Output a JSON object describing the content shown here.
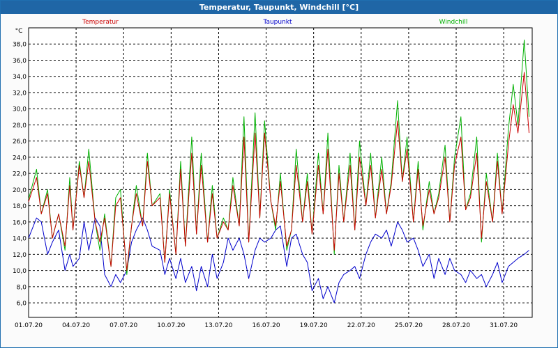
{
  "window": {
    "title": "Temperatur, Taupunkt, Windchill [°C]"
  },
  "chart_data": {
    "type": "line",
    "title": "Temperatur, Taupunkt, Windchill [°C]",
    "ylabel": "°C",
    "ylim": [
      4.2,
      40.0
    ],
    "xlim": [
      0,
      31.8
    ],
    "grid": true,
    "legend": "top",
    "yticks": [
      "6,0",
      "8,0",
      "10,0",
      "12,0",
      "14,0",
      "16,0",
      "18,0",
      "20,0",
      "22,0",
      "24,0",
      "26,0",
      "28,0",
      "30,0",
      "32,0",
      "34,0",
      "36,0",
      "38,0"
    ],
    "ytick_values": [
      6,
      8,
      10,
      12,
      14,
      16,
      18,
      20,
      22,
      24,
      26,
      28,
      30,
      32,
      34,
      36,
      38
    ],
    "xticks": [
      "01.07.20",
      "04.07.20",
      "07.07.20",
      "10.07.20",
      "13.07.20",
      "16.07.20",
      "19.07.20",
      "22.07.20",
      "25.07.20",
      "28.07.20",
      "31.07.20"
    ],
    "xtick_values": [
      0,
      3,
      6,
      9,
      12,
      15,
      18,
      21,
      24,
      27,
      30
    ],
    "series": [
      {
        "name": "Temperatur",
        "color": "#cc0000",
        "x": [
          0,
          0.5,
          0.8,
          1.2,
          1.5,
          1.9,
          2.3,
          2.6,
          2.8,
          3.2,
          3.5,
          3.8,
          4.2,
          4.5,
          4.8,
          5.2,
          5.5,
          5.8,
          6.2,
          6.5,
          6.8,
          7.2,
          7.5,
          7.8,
          8.3,
          8.6,
          8.9,
          9.3,
          9.6,
          9.9,
          10.3,
          10.6,
          10.9,
          11.3,
          11.6,
          11.9,
          12.3,
          12.6,
          12.9,
          13.3,
          13.6,
          13.9,
          14.3,
          14.6,
          14.9,
          15.3,
          15.6,
          15.9,
          16.3,
          16.6,
          16.9,
          17.3,
          17.6,
          17.9,
          18.3,
          18.6,
          18.9,
          19.3,
          19.6,
          19.9,
          20.3,
          20.6,
          20.9,
          21.3,
          21.6,
          21.9,
          22.3,
          22.6,
          22.9,
          23.3,
          23.6,
          23.9,
          24.3,
          24.6,
          24.9,
          25.3,
          25.6,
          25.9,
          26.3,
          26.6,
          26.9,
          27.3,
          27.6,
          27.9,
          28.3,
          28.6,
          28.9,
          29.3,
          29.6,
          29.9,
          30.3,
          30.6,
          30.9,
          31.3,
          31.6
        ],
        "values": [
          18.5,
          21.5,
          17.0,
          19.5,
          14.0,
          17.0,
          13.0,
          20.5,
          15.0,
          23.0,
          19.0,
          23.5,
          16.0,
          13.5,
          16.5,
          10.5,
          18.0,
          19.0,
          10.0,
          15.5,
          19.5,
          15.5,
          23.5,
          18.0,
          19.0,
          11.0,
          19.5,
          12.0,
          22.5,
          13.0,
          24.5,
          14.5,
          23.0,
          13.5,
          19.5,
          14.0,
          16.0,
          15.0,
          20.5,
          15.5,
          26.5,
          13.5,
          27.0,
          16.5,
          27.0,
          18.5,
          15.5,
          21.0,
          13.0,
          15.0,
          23.0,
          16.0,
          21.0,
          14.5,
          23.0,
          17.0,
          25.0,
          12.5,
          22.0,
          16.0,
          23.0,
          15.0,
          24.0,
          18.0,
          23.0,
          16.5,
          22.5,
          17.0,
          20.5,
          28.5,
          21.0,
          25.0,
          16.0,
          22.5,
          15.5,
          20.0,
          17.0,
          19.0,
          24.0,
          16.0,
          23.0,
          26.5,
          17.5,
          19.0,
          24.5,
          14.0,
          21.0,
          16.0,
          23.5,
          17.0,
          25.5,
          30.5,
          27.0,
          34.5,
          27.0
        ]
      },
      {
        "name": "Taupunkt",
        "color": "#0000cc",
        "x": [
          0,
          0.5,
          0.8,
          1.2,
          1.5,
          1.9,
          2.3,
          2.6,
          2.8,
          3.2,
          3.5,
          3.8,
          4.2,
          4.5,
          4.8,
          5.2,
          5.5,
          5.8,
          6.2,
          6.5,
          6.8,
          7.2,
          7.5,
          7.8,
          8.3,
          8.6,
          8.9,
          9.3,
          9.6,
          9.9,
          10.3,
          10.6,
          10.9,
          11.3,
          11.6,
          11.9,
          12.3,
          12.6,
          12.9,
          13.3,
          13.6,
          13.9,
          14.3,
          14.6,
          14.9,
          15.3,
          15.6,
          15.9,
          16.3,
          16.6,
          16.9,
          17.3,
          17.6,
          17.9,
          18.3,
          18.6,
          18.9,
          19.3,
          19.6,
          19.9,
          20.3,
          20.6,
          20.9,
          21.3,
          21.6,
          21.9,
          22.3,
          22.6,
          22.9,
          23.3,
          23.6,
          23.9,
          24.3,
          24.6,
          24.9,
          25.3,
          25.6,
          25.9,
          26.3,
          26.6,
          26.9,
          27.3,
          27.6,
          27.9,
          28.3,
          28.6,
          28.9,
          29.3,
          29.6,
          29.9,
          30.3,
          30.6,
          30.9,
          31.3,
          31.6
        ],
        "values": [
          14.0,
          16.5,
          16.0,
          12.0,
          13.5,
          15.0,
          10.0,
          12.0,
          10.5,
          11.5,
          16.0,
          12.5,
          16.5,
          15.5,
          9.5,
          8.0,
          9.5,
          8.5,
          10.0,
          13.5,
          15.0,
          16.5,
          15.0,
          13.0,
          12.5,
          9.5,
          11.5,
          9.0,
          11.5,
          8.5,
          10.5,
          7.5,
          10.5,
          8.0,
          12.0,
          9.0,
          11.0,
          14.0,
          12.5,
          14.0,
          12.0,
          9.0,
          12.5,
          14.0,
          13.5,
          14.0,
          15.0,
          15.5,
          10.5,
          14.0,
          14.5,
          12.0,
          11.0,
          7.5,
          9.0,
          6.5,
          8.0,
          6.0,
          8.5,
          9.5,
          10.0,
          10.5,
          9.0,
          12.0,
          13.5,
          14.5,
          14.0,
          15.0,
          13.0,
          16.0,
          15.0,
          13.5,
          14.0,
          12.5,
          10.5,
          12.0,
          9.0,
          11.5,
          9.5,
          11.5,
          10.0,
          9.5,
          8.5,
          10.0,
          9.0,
          9.5,
          8.0,
          9.5,
          11.0,
          8.5,
          10.5,
          11.0,
          11.5,
          12.0,
          12.5
        ]
      },
      {
        "name": "Windchill",
        "color": "#00b000",
        "x": [
          0,
          0.5,
          0.8,
          1.2,
          1.5,
          1.9,
          2.3,
          2.6,
          2.8,
          3.2,
          3.5,
          3.8,
          4.2,
          4.5,
          4.8,
          5.2,
          5.5,
          5.8,
          6.2,
          6.5,
          6.8,
          7.2,
          7.5,
          7.8,
          8.3,
          8.6,
          8.9,
          9.3,
          9.6,
          9.9,
          10.3,
          10.6,
          10.9,
          11.3,
          11.6,
          11.9,
          12.3,
          12.6,
          12.9,
          13.3,
          13.6,
          13.9,
          14.3,
          14.6,
          14.9,
          15.3,
          15.6,
          15.9,
          16.3,
          16.6,
          16.9,
          17.3,
          17.6,
          17.9,
          18.3,
          18.6,
          18.9,
          19.3,
          19.6,
          19.9,
          20.3,
          20.6,
          20.9,
          21.3,
          21.6,
          21.9,
          22.3,
          22.6,
          22.9,
          23.3,
          23.6,
          23.9,
          24.3,
          24.6,
          24.9,
          25.3,
          25.6,
          25.9,
          26.3,
          26.6,
          26.9,
          27.3,
          27.6,
          27.9,
          28.3,
          28.6,
          28.9,
          29.3,
          29.6,
          29.9,
          30.3,
          30.6,
          30.9,
          31.3,
          31.6
        ],
        "values": [
          18.8,
          22.5,
          17.0,
          20.0,
          14.0,
          17.0,
          12.5,
          21.5,
          15.0,
          23.5,
          19.0,
          25.0,
          16.0,
          12.5,
          17.0,
          10.5,
          19.0,
          20.0,
          9.5,
          15.5,
          20.5,
          15.5,
          24.5,
          18.0,
          19.5,
          11.0,
          20.0,
          12.0,
          23.5,
          13.0,
          26.5,
          14.5,
          24.5,
          13.5,
          20.5,
          14.0,
          16.5,
          15.0,
          21.5,
          15.5,
          29.0,
          13.5,
          29.5,
          16.5,
          28.5,
          18.5,
          15.0,
          22.0,
          12.5,
          15.0,
          25.0,
          16.0,
          22.0,
          14.5,
          24.5,
          17.0,
          27.0,
          12.0,
          23.0,
          16.0,
          24.5,
          15.0,
          26.0,
          18.0,
          24.5,
          16.5,
          24.0,
          17.0,
          21.0,
          31.0,
          21.0,
          26.5,
          16.0,
          23.5,
          15.0,
          21.0,
          17.0,
          19.5,
          25.5,
          16.0,
          24.0,
          29.0,
          17.5,
          19.5,
          26.5,
          13.5,
          22.0,
          16.0,
          24.5,
          17.0,
          27.5,
          33.0,
          28.0,
          38.5,
          29.0
        ]
      }
    ]
  }
}
